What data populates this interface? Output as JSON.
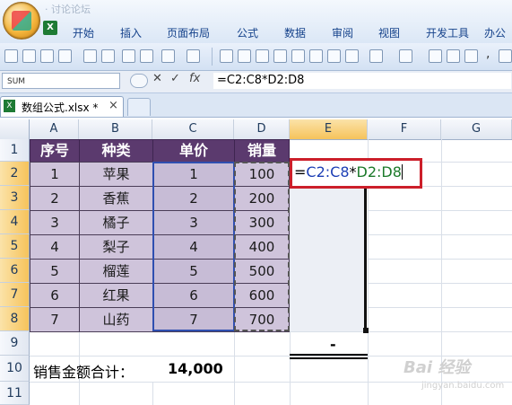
{
  "ribbon": {
    "tabs": [
      "开始",
      "插入",
      "页面布局",
      "公式",
      "数据",
      "审阅",
      "视图",
      "开发工具",
      "办公"
    ],
    "faded_qat_text": "· 讨论论坛"
  },
  "formula_bar": {
    "name_box": "SUM",
    "cancel": "✕",
    "enter": "✓",
    "fx": "fx",
    "formula": "=C2:C8*D2:D8"
  },
  "workbook": {
    "tab_label": "数组公式.xlsx *",
    "close": "×"
  },
  "columns": [
    "A",
    "B",
    "C",
    "D",
    "E",
    "F",
    "G"
  ],
  "rows": [
    "1",
    "2",
    "3",
    "4",
    "5",
    "6",
    "7",
    "8",
    "9",
    "10",
    "11"
  ],
  "table": {
    "headers": [
      "序号",
      "种类",
      "单价",
      "销量"
    ],
    "rows": [
      [
        "1",
        "苹果",
        "1",
        "100"
      ],
      [
        "2",
        "香蕉",
        "2",
        "200"
      ],
      [
        "3",
        "橘子",
        "3",
        "300"
      ],
      [
        "4",
        "梨子",
        "4",
        "400"
      ],
      [
        "5",
        "榴莲",
        "5",
        "500"
      ],
      [
        "6",
        "红果",
        "6",
        "600"
      ],
      [
        "7",
        "山药",
        "7",
        "700"
      ]
    ]
  },
  "edit_cell": {
    "eq": "=",
    "range1": "C2:C8",
    "op": "*",
    "range2": "D2:D8"
  },
  "e9_value": "-",
  "total": {
    "label": "销售金额合计：",
    "value": "14,000"
  },
  "watermark": {
    "main": "Bai 经验",
    "sub": "jingyan.baidu.com"
  },
  "colors": {
    "header_fill": "#5b3a6e",
    "data_fill": "#cfc4db",
    "highlight_box": "#cc1f2a"
  }
}
